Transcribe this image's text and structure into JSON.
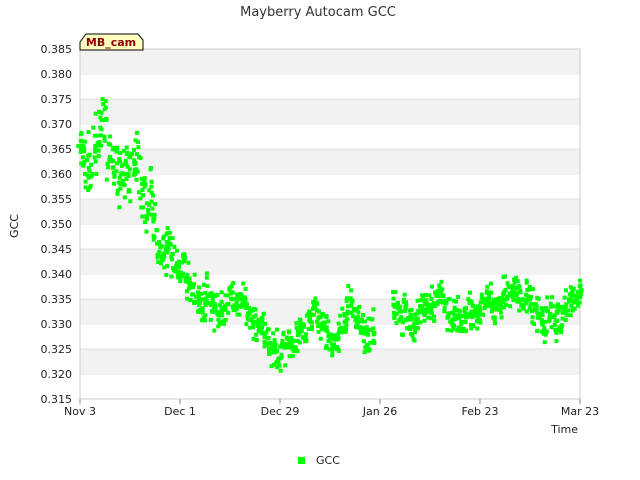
{
  "chart_data": {
    "type": "scatter",
    "title": "Mayberry Autocam GCC",
    "xlabel": "Time",
    "ylabel": "GCC",
    "site_tag": "MB_cam",
    "x_ticks": [
      "Nov 3",
      "Dec 1",
      "Dec 29",
      "Jan 26",
      "Feb 23",
      "Mar 23"
    ],
    "xlim": [
      "Nov 3",
      "Mar 23"
    ],
    "ylim": [
      0.315,
      0.385
    ],
    "y_ticks": [
      "0.315",
      "0.320",
      "0.325",
      "0.330",
      "0.335",
      "0.340",
      "0.345",
      "0.350",
      "0.355",
      "0.360",
      "0.365",
      "0.370",
      "0.375",
      "0.380",
      "0.385"
    ],
    "grid": "horizontal alternating bands",
    "legend": "bottom-center",
    "series": [
      {
        "name": "GCC",
        "color": "#00ff00",
        "marker": "square",
        "points": [
          [
            "Nov 3",
            0.366
          ],
          [
            "Nov 4",
            0.364
          ],
          [
            "Nov 5",
            0.362
          ],
          [
            "Nov 6",
            0.36
          ],
          [
            "Nov 7",
            0.365
          ],
          [
            "Nov 8",
            0.367
          ],
          [
            "Nov 9",
            0.372
          ],
          [
            "Nov 10",
            0.368
          ],
          [
            "Nov 11",
            0.364
          ],
          [
            "Nov 12",
            0.363
          ],
          [
            "Nov 13",
            0.362
          ],
          [
            "Nov 14",
            0.36
          ],
          [
            "Nov 15",
            0.359
          ],
          [
            "Nov 16",
            0.361
          ],
          [
            "Nov 17",
            0.36
          ],
          [
            "Nov 18",
            0.361
          ],
          [
            "Nov 19",
            0.363
          ],
          [
            "Nov 20",
            0.358
          ],
          [
            "Nov 21",
            0.356
          ],
          [
            "Nov 22",
            0.353
          ],
          [
            "Nov 23",
            0.355
          ],
          [
            "Nov 24",
            0.35
          ],
          [
            "Nov 25",
            0.346
          ],
          [
            "Nov 26",
            0.345
          ],
          [
            "Nov 27",
            0.344
          ],
          [
            "Nov 28",
            0.347
          ],
          [
            "Nov 29",
            0.343
          ],
          [
            "Nov 30",
            0.341
          ],
          [
            "Dec 1",
            0.34
          ],
          [
            "Dec 2",
            0.341
          ],
          [
            "Dec 3",
            0.339
          ],
          [
            "Dec 4",
            0.337
          ],
          [
            "Dec 5",
            0.336
          ],
          [
            "Dec 6",
            0.335
          ],
          [
            "Dec 7",
            0.333
          ],
          [
            "Dec 8",
            0.334
          ],
          [
            "Dec 9",
            0.336
          ],
          [
            "Dec 10",
            0.334
          ],
          [
            "Dec 11",
            0.332
          ],
          [
            "Dec 12",
            0.333
          ],
          [
            "Dec 13",
            0.332
          ],
          [
            "Dec 14",
            0.334
          ],
          [
            "Dec 15",
            0.336
          ],
          [
            "Dec 16",
            0.335
          ],
          [
            "Dec 17",
            0.333
          ],
          [
            "Dec 18",
            0.334
          ],
          [
            "Dec 19",
            0.334
          ],
          [
            "Dec 20",
            0.332
          ],
          [
            "Dec 21",
            0.331
          ],
          [
            "Dec 22",
            0.33
          ],
          [
            "Dec 23",
            0.33
          ],
          [
            "Dec 24",
            0.329
          ],
          [
            "Dec 25",
            0.327
          ],
          [
            "Dec 26",
            0.326
          ],
          [
            "Dec 27",
            0.325
          ],
          [
            "Dec 28",
            0.325
          ],
          [
            "Dec 29",
            0.324
          ],
          [
            "Dec 30",
            0.325
          ],
          [
            "Dec 31",
            0.326
          ],
          [
            "Jan 1",
            0.327
          ],
          [
            "Jan 2",
            0.326
          ],
          [
            "Jan 3",
            0.328
          ],
          [
            "Jan 4",
            0.329
          ],
          [
            "Jan 5",
            0.328
          ],
          [
            "Jan 6",
            0.33
          ],
          [
            "Jan 7",
            0.331
          ],
          [
            "Jan 8",
            0.332
          ],
          [
            "Jan 9",
            0.33
          ],
          [
            "Jan 10",
            0.331
          ],
          [
            "Jan 11",
            0.329
          ],
          [
            "Jan 12",
            0.328
          ],
          [
            "Jan 13",
            0.326
          ],
          [
            "Jan 14",
            0.327
          ],
          [
            "Jan 15",
            0.329
          ],
          [
            "Jan 16",
            0.331
          ],
          [
            "Jan 17",
            0.333
          ],
          [
            "Jan 18",
            0.334
          ],
          [
            "Jan 19",
            0.332
          ],
          [
            "Jan 20",
            0.331
          ],
          [
            "Jan 21",
            0.329
          ],
          [
            "Jan 22",
            0.327
          ],
          [
            "Jan 23",
            0.328
          ],
          [
            "Jan 24",
            0.329
          ],
          [
            "Jan 30",
            0.334
          ],
          [
            "Jan 31",
            0.333
          ],
          [
            "Feb 1",
            0.332
          ],
          [
            "Feb 2",
            0.333
          ],
          [
            "Feb 3",
            0.331
          ],
          [
            "Feb 4",
            0.33
          ],
          [
            "Feb 5",
            0.331
          ],
          [
            "Feb 6",
            0.332
          ],
          [
            "Feb 7",
            0.333
          ],
          [
            "Feb 8",
            0.334
          ],
          [
            "Feb 9",
            0.333
          ],
          [
            "Feb 10",
            0.334
          ],
          [
            "Feb 11",
            0.335
          ],
          [
            "Feb 12",
            0.336
          ],
          [
            "Feb 13",
            0.334
          ],
          [
            "Feb 14",
            0.333
          ],
          [
            "Feb 15",
            0.331
          ],
          [
            "Feb 16",
            0.332
          ],
          [
            "Feb 17",
            0.331
          ],
          [
            "Feb 18",
            0.33
          ],
          [
            "Feb 19",
            0.331
          ],
          [
            "Feb 20",
            0.333
          ],
          [
            "Feb 21",
            0.332
          ],
          [
            "Feb 22",
            0.331
          ],
          [
            "Feb 23",
            0.334
          ],
          [
            "Feb 24",
            0.333
          ],
          [
            "Feb 25",
            0.335
          ],
          [
            "Feb 26",
            0.334
          ],
          [
            "Feb 27",
            0.333
          ],
          [
            "Feb 28",
            0.334
          ],
          [
            "Mar 1",
            0.335
          ],
          [
            "Mar 2",
            0.336
          ],
          [
            "Mar 3",
            0.335
          ],
          [
            "Mar 4",
            0.336
          ],
          [
            "Mar 5",
            0.337
          ],
          [
            "Mar 6",
            0.335
          ],
          [
            "Mar 7",
            0.334
          ],
          [
            "Mar 8",
            0.336
          ],
          [
            "Mar 9",
            0.335
          ],
          [
            "Mar 10",
            0.333
          ],
          [
            "Mar 11",
            0.332
          ],
          [
            "Mar 12",
            0.331
          ],
          [
            "Mar 13",
            0.33
          ],
          [
            "Mar 14",
            0.331
          ],
          [
            "Mar 15",
            0.332
          ],
          [
            "Mar 16",
            0.33
          ],
          [
            "Mar 17",
            0.332
          ],
          [
            "Mar 18",
            0.331
          ],
          [
            "Mar 19",
            0.333
          ],
          [
            "Mar 20",
            0.335
          ],
          [
            "Mar 21",
            0.336
          ],
          [
            "Mar 22",
            0.335
          ],
          [
            "Mar 23",
            0.336
          ]
        ]
      }
    ]
  }
}
